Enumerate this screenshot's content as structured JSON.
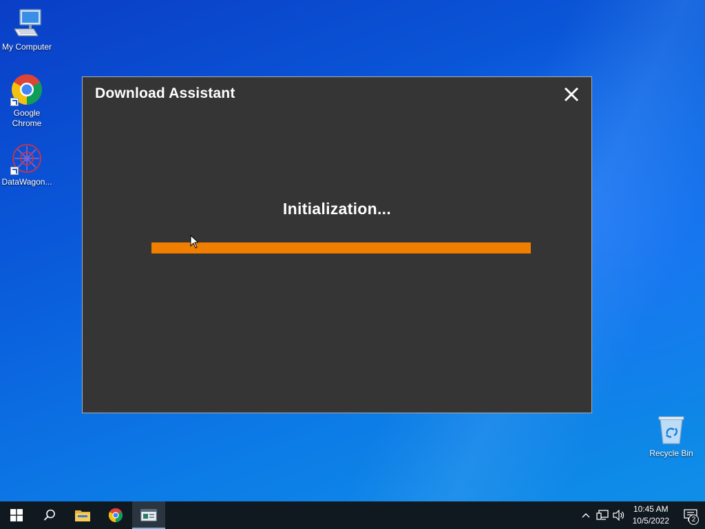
{
  "desktop": {
    "icons": [
      {
        "label": "My Computer",
        "icon": "computer-icon"
      },
      {
        "label": "Google Chrome",
        "icon": "chrome-icon"
      },
      {
        "label": "DataWagon...",
        "icon": "datawagon-icon"
      },
      {
        "label": "Recycle Bin",
        "icon": "recycle-bin-icon"
      }
    ]
  },
  "window": {
    "title": "Download Assistant",
    "status": "Initialization...",
    "progress_percent": 100,
    "close_icon": "close-icon",
    "accent_color": "#f07f00",
    "background_color": "#353535"
  },
  "taskbar": {
    "buttons": [
      {
        "icon": "windows-start-icon"
      },
      {
        "icon": "search-icon"
      },
      {
        "icon": "file-explorer-icon"
      },
      {
        "icon": "chrome-icon"
      },
      {
        "icon": "download-assistant-app-icon",
        "active": true
      }
    ],
    "tray": {
      "icons": [
        "chevron-up-icon",
        "network-icon",
        "volume-icon"
      ],
      "time": "10:45 AM",
      "date": "10/5/2022",
      "notification_count": "2"
    }
  }
}
